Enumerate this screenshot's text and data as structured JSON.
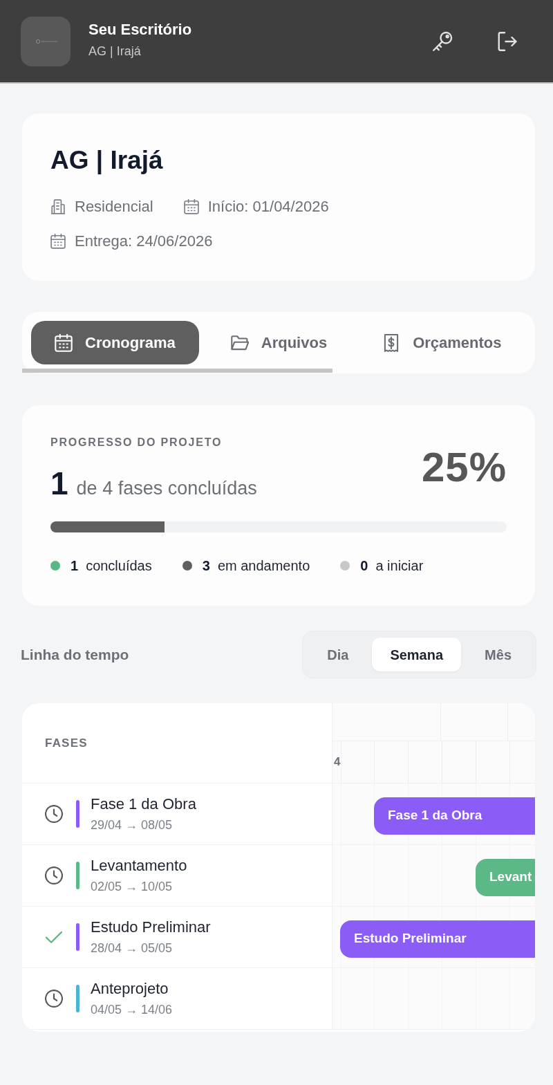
{
  "header": {
    "title": "Seu Escritório",
    "subtitle": "AG | Irajá"
  },
  "project": {
    "title": "AG | Irajá",
    "meta": [
      {
        "text": "Residencial"
      },
      {
        "text": "Início: 01/04/2026"
      },
      {
        "text": "Entrega: 24/06/2026"
      }
    ]
  },
  "tabs": [
    {
      "label": "Cronograma",
      "selected": true
    },
    {
      "label": "Arquivos",
      "selected": false
    },
    {
      "label": "Orçamentos",
      "selected": false
    }
  ],
  "progress": {
    "title": "PROGRESSO DO PROJETO",
    "count": "1",
    "count_text": "de 4 fases concluídas",
    "percent": "25%",
    "level": 0.25,
    "legend": [
      {
        "count": "1",
        "label": "concluídas",
        "color": "#58b883"
      },
      {
        "count": "3",
        "label": "em andamento",
        "color": "#5f5f5f"
      },
      {
        "count": "0",
        "label": "a iniciar",
        "color": "#c8c8c8"
      }
    ]
  },
  "timeline": {
    "title": "Linha do tempo",
    "views": [
      {
        "label": "Dia",
        "selected": false
      },
      {
        "label": "Semana",
        "selected": true
      },
      {
        "label": "Mês",
        "selected": false
      }
    ],
    "phases_heading": "FASES",
    "day_labels": [
      "4"
    ],
    "phases": [
      {
        "name": "Fase 1 da Obra",
        "dates": "29/04 → 08/05",
        "done": false,
        "color": "#8b5cf6",
        "bar_label": "Fase 1 da Obra"
      },
      {
        "name": "Levantamento",
        "dates": "02/05 → 10/05",
        "done": false,
        "color": "#5cb887",
        "bar_label": "Levant"
      },
      {
        "name": "Estudo Preliminar",
        "dates": "28/04 → 05/05",
        "done": true,
        "color": "#8b5cf6",
        "bar_label": "Estudo Preliminar"
      },
      {
        "name": "Anteprojeto",
        "dates": "04/05 → 14/06",
        "done": false,
        "color": "#4cb3d4"
      }
    ]
  }
}
